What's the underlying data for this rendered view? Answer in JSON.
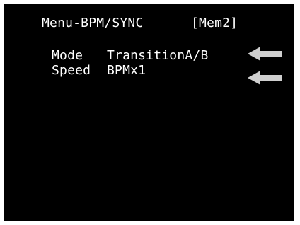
{
  "menu": {
    "title": "Menu-BPM/SYNC",
    "memory_slot": "[Mem2]"
  },
  "items": [
    {
      "label": "Mode",
      "value": "TransitionA/B",
      "selected_icon": "left-arrow-icon"
    },
    {
      "label": "Speed",
      "value": "BPMx1",
      "selected_icon": "left-arrow-icon"
    }
  ],
  "colors": {
    "background": "#000000",
    "text": "#ffffff",
    "arrow": "#cfcfcf",
    "frame": "#ffffff"
  }
}
